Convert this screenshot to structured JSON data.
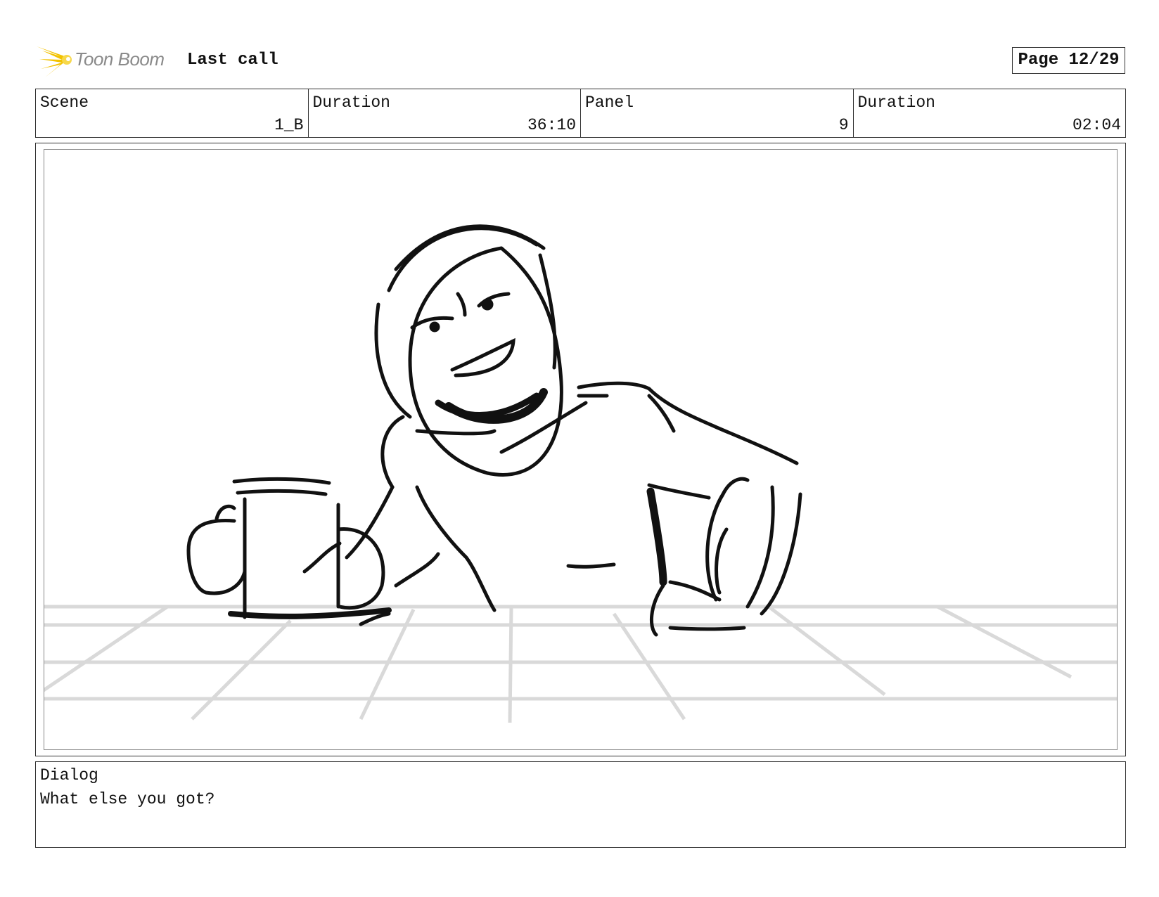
{
  "header": {
    "logo_text": "Toon Boom",
    "project_title": "Last call",
    "page_label": "Page 12/29"
  },
  "info_table": [
    {
      "label": "Scene",
      "value": "1_B"
    },
    {
      "label": "Duration",
      "value": "36:10"
    },
    {
      "label": "Panel",
      "value": "9"
    },
    {
      "label": "Duration",
      "value": "02:04"
    }
  ],
  "panel": {
    "image_icon": "storyboard-sketch"
  },
  "dialog": {
    "label": "Dialog",
    "text": "What else you got?"
  },
  "colors": {
    "logo_accent": "#f2c200",
    "logo_text": "#8a8a8a",
    "border": "#333333",
    "sketch_line": "#111111",
    "floor_grid": "#d9d9d9"
  }
}
